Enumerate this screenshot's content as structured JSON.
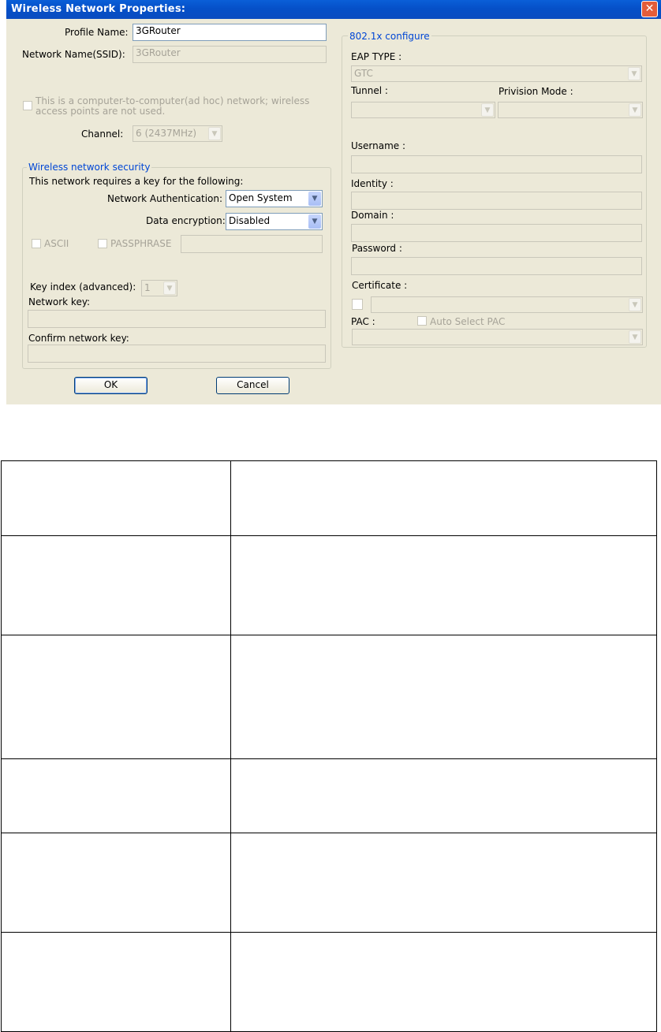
{
  "dialog": {
    "title": "Wireless Network Properties:",
    "close_glyph": "✕",
    "profile_name_label": "Profile Name:",
    "profile_name_value": "3GRouter",
    "ssid_label": "Network Name(SSID):",
    "ssid_value": "3GRouter",
    "adhoc_text_line1": "This is a computer-to-computer(ad hoc) network; wireless",
    "adhoc_text_line2": "access points are not used.",
    "channel_label": "Channel:",
    "channel_value": "6  (2437MHz)",
    "security": {
      "title": "Wireless network security",
      "requires_text": "This network requires a key for the following:",
      "auth_label": "Network Authentication:",
      "auth_value": "Open System",
      "encryption_label": "Data encryption:",
      "encryption_value": "Disabled",
      "ascii_label": "ASCII",
      "passphrase_label": "PASSPHRASE",
      "key_index_label": "Key index (advanced):",
      "key_index_value": "1",
      "network_key_label": "Network key:",
      "confirm_key_label": "Confirm network key:"
    },
    "dot1x": {
      "title": "802.1x configure",
      "eap_type_label": "EAP TYPE :",
      "eap_type_value": "GTC",
      "tunnel_label": "Tunnel :",
      "provision_label": "Privision Mode :",
      "username_label": "Username :",
      "identity_label": "Identity :",
      "domain_label": "Domain :",
      "password_label": "Password :",
      "certificate_label": "Certificate :",
      "pac_label": "PAC :",
      "auto_pac_label": "Auto Select PAC"
    },
    "ok_label": "OK",
    "cancel_label": "Cancel"
  },
  "table": {
    "rows": [
      [
        "",
        ""
      ],
      [
        "",
        ""
      ],
      [
        "",
        ""
      ],
      [
        "",
        ""
      ],
      [
        "",
        ""
      ],
      [
        "",
        ""
      ]
    ]
  }
}
